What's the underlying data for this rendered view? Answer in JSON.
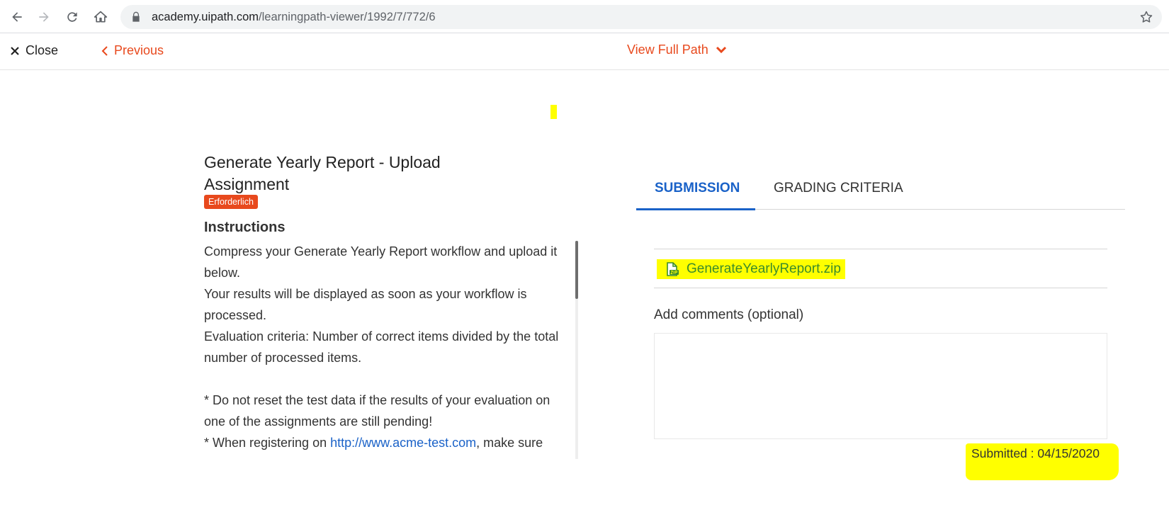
{
  "browser": {
    "url_domain": "academy.uipath.com",
    "url_path": "/learningpath-viewer/1992/7/772/6"
  },
  "app_bar": {
    "close_label": "Close",
    "previous_label": "Previous",
    "view_full_path_label": "View Full Path"
  },
  "assignment": {
    "title": "Generate Yearly Report - Upload Assignment",
    "badge": "Erforderlich",
    "instructions_heading": "Instructions",
    "instructions": {
      "p1": "Compress your Generate Yearly Report workflow and upload it below.",
      "p2": "Your results will be displayed as soon as your workflow is processed.",
      "p3": "Evaluation criteria: Number of correct items divided by the total number of processed items.",
      "p4": " * Do not reset the test data if the results of your evaluation on one of the assignments are still pending!",
      "p5_prefix": " * When registering on ",
      "p5_link": "http://www.acme-test.com",
      "p5_suffix": ", make sure"
    }
  },
  "tabs": {
    "submission": "SUBMISSION",
    "grading": "GRADING CRITERIA"
  },
  "submission": {
    "file_name": "GenerateYearlyReport.zip",
    "comments_label": "Add comments (optional)",
    "submitted_text": "Submitted : 04/15/2020"
  },
  "colors": {
    "accent_orange": "#e8491d",
    "accent_blue": "#1a62c8",
    "highlight": "#ffff00"
  }
}
